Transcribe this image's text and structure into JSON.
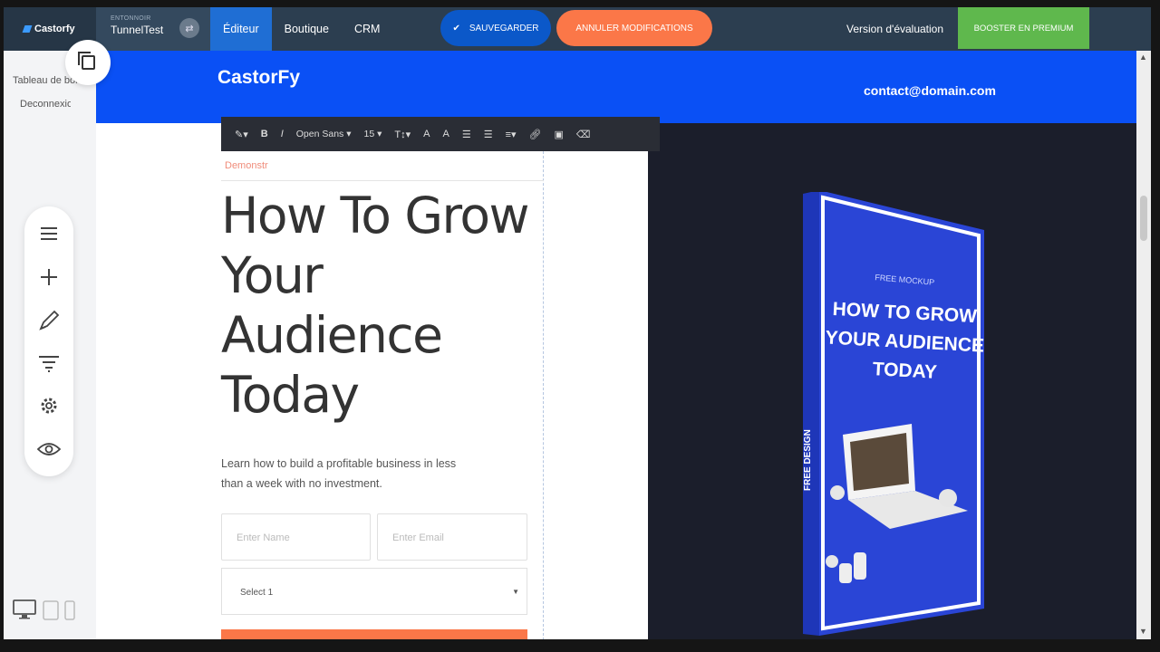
{
  "topbar": {
    "logo_text": "Castorfy",
    "funnel_label": "ENTONNOIR",
    "funnel_name": "TunnelTest",
    "tabs": [
      "Éditeur",
      "Boutique",
      "CRM"
    ],
    "save_label": "Sauvegarder",
    "cancel_label": "Annuler modifications",
    "trial_label": "Version d'évaluation",
    "premium_label": "Booster en premium"
  },
  "sidebar": {
    "links": [
      "Tableau de bord",
      "Deconnexion"
    ]
  },
  "page": {
    "brand": "CastorFy",
    "contact": "contact@domain.com",
    "toolbar": {
      "font_family": "Open Sans",
      "font_size": "15"
    },
    "label_field_value": "Demonstr",
    "headline": "How To Grow Your Audience Today",
    "subtext": "Learn how to build a profitable business in less than a week with no investment.",
    "name_placeholder": "Enter Name",
    "email_placeholder": "Enter Email",
    "select_value": "Select 1",
    "book": {
      "kicker": "FREE MOCKUP",
      "title_lines": [
        "HOW TO GROW",
        "YOUR AUDIENCE",
        "TODAY"
      ],
      "spine": "FREE DESIGN"
    }
  },
  "colors": {
    "topbar": "#2c3e50",
    "active_tab": "#1f6ed4",
    "save": "#0b58c9",
    "cancel": "#fb7748",
    "premium": "#5fb84d",
    "header_band": "#0a50f5",
    "book": "#2a45d6"
  }
}
